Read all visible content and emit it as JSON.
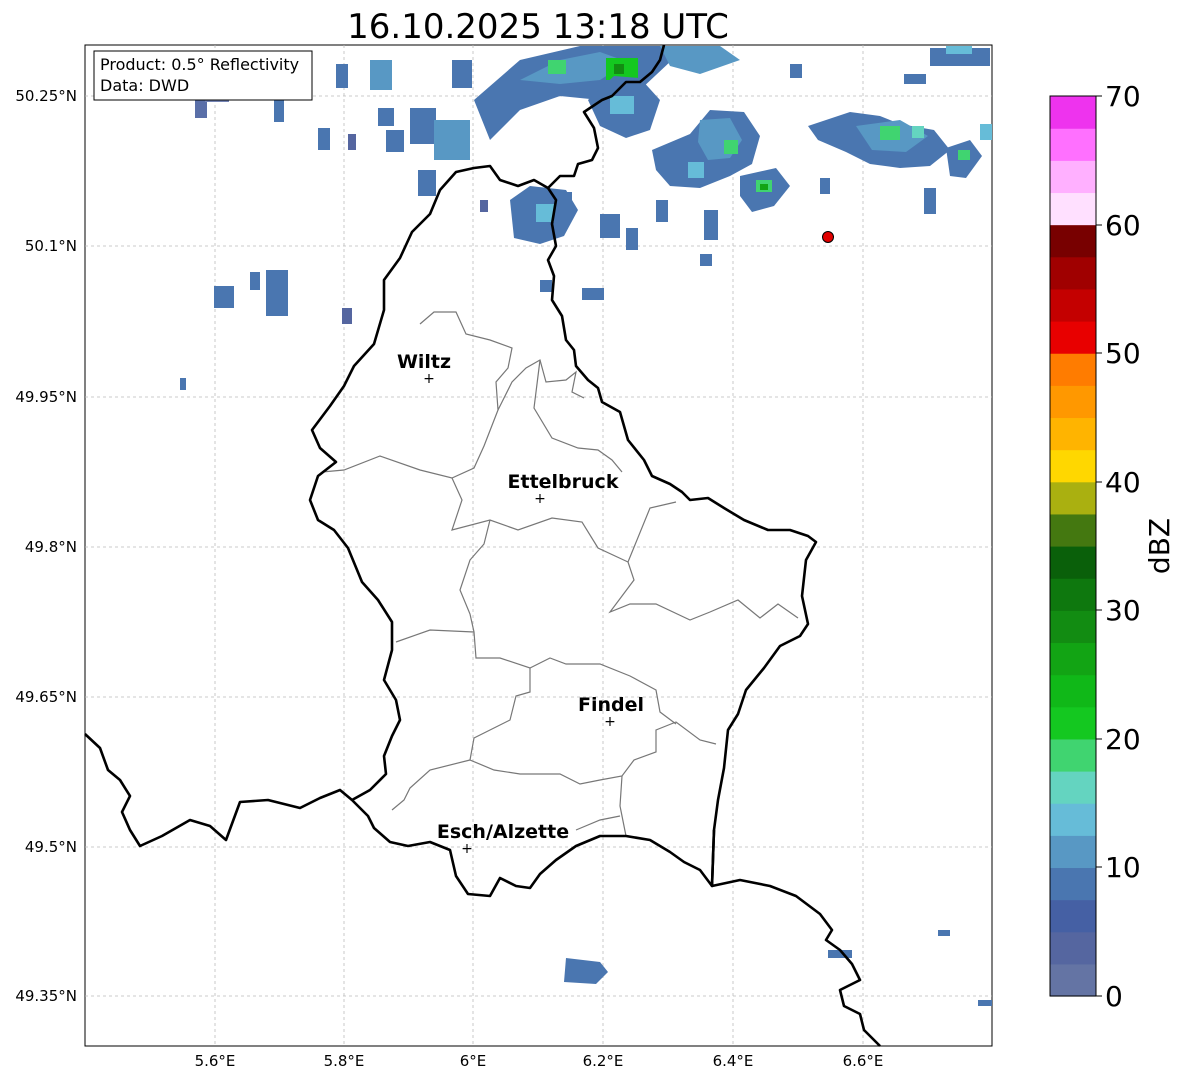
{
  "title": "16.10.2025 13:18 UTC",
  "info_box": {
    "line1": "Product: 0.5° Reflectivity",
    "line2": "Data: DWD"
  },
  "axes": {
    "lon_ticks": [
      "5.6°E",
      "5.8°E",
      "6°E",
      "6.2°E",
      "6.4°E",
      "6.6°E"
    ],
    "lat_ticks": [
      "50.25°N",
      "50.1°N",
      "49.95°N",
      "49.8°N",
      "49.65°N",
      "49.5°N",
      "49.35°N"
    ],
    "grid": true
  },
  "cities": [
    {
      "name": "Wiltz",
      "lon": 5.93,
      "lat": 49.967
    },
    {
      "name": "Ettelbruck",
      "lon": 6.1,
      "lat": 49.847
    },
    {
      "name": "Findel",
      "lon": 6.21,
      "lat": 49.627
    },
    {
      "name": "Esch/Alzette",
      "lon": 5.99,
      "lat": 49.497
    }
  ],
  "marker": {
    "lon": 6.55,
    "lat": 50.108,
    "color": "#e00000"
  },
  "colorbar": {
    "label": "dBZ",
    "ticks": [
      "0",
      "10",
      "20",
      "30",
      "40",
      "50",
      "60",
      "70"
    ],
    "colors": [
      "#6474a4",
      "#5566a0",
      "#4560a4",
      "#4a76b0",
      "#5898c4",
      "#66bcd8",
      "#64d4c0",
      "#40d470",
      "#14c820",
      "#10b818",
      "#12a414",
      "#128c12",
      "#0e780e",
      "#0a600a",
      "#447810",
      "#aab010",
      "#ffd700",
      "#ffb400",
      "#ff9800",
      "#ff7c00",
      "#e80000",
      "#c40000",
      "#a00000",
      "#780000",
      "#ffe0ff",
      "#ffb0ff",
      "#ff70ff",
      "#ee33ee"
    ]
  }
}
